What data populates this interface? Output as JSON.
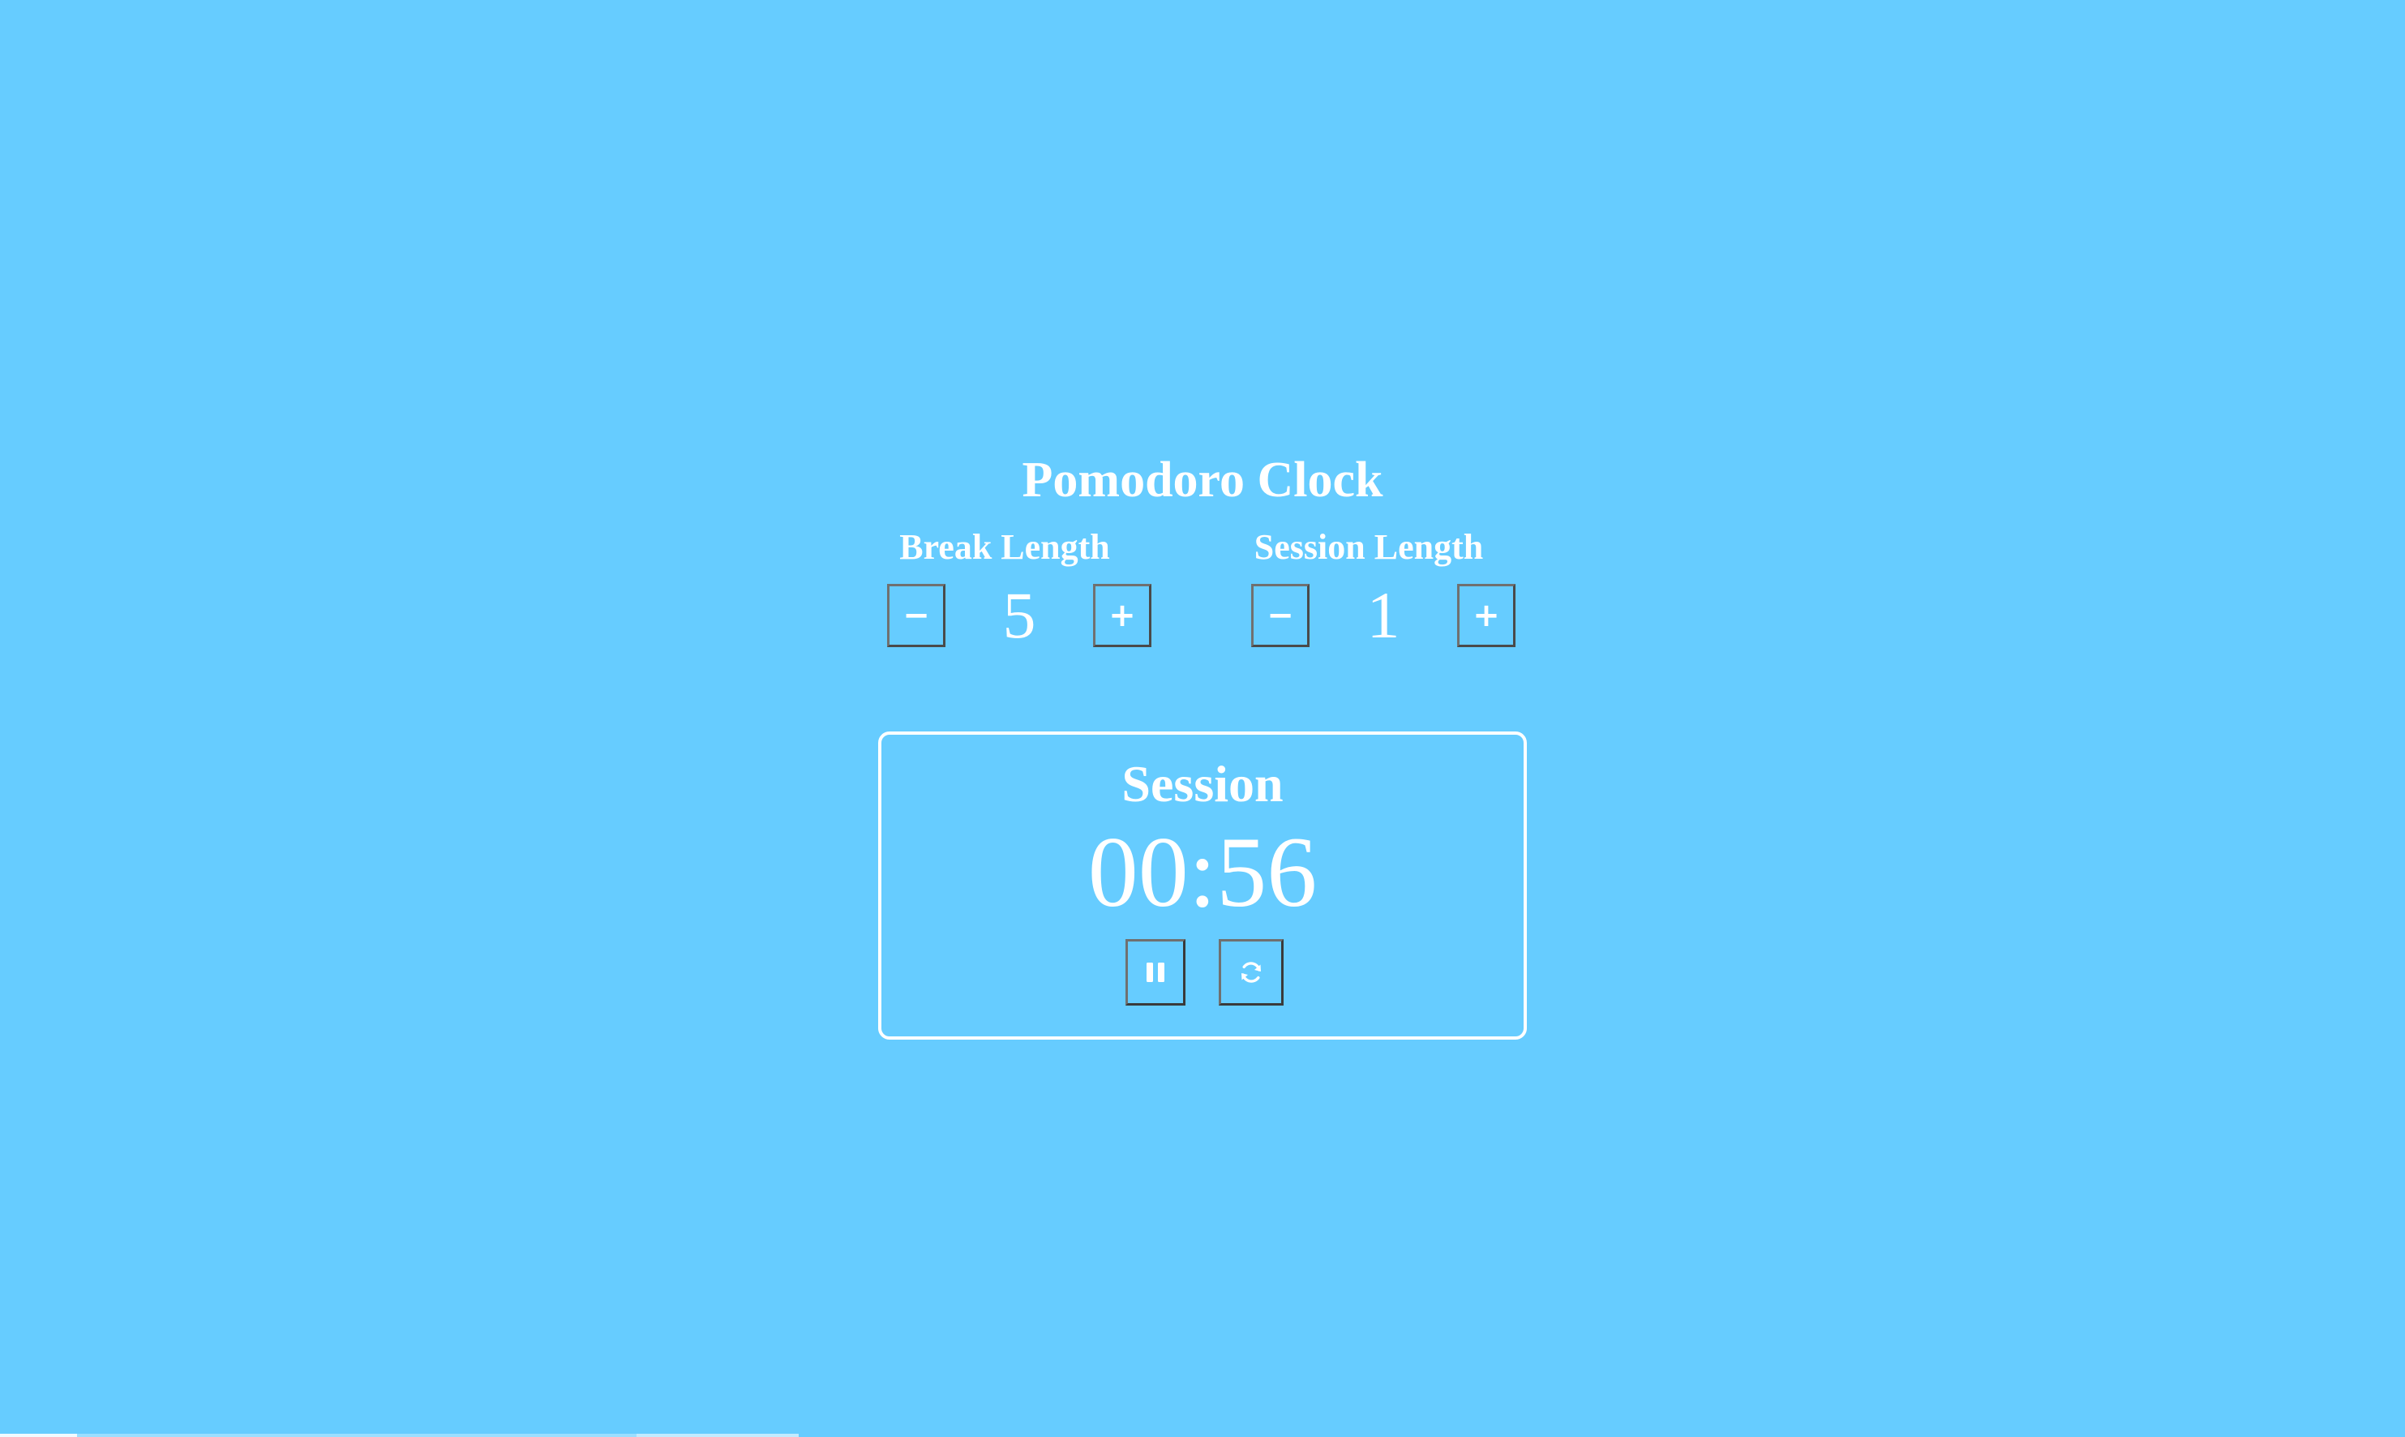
{
  "app": {
    "title": "Pomodoro Clock",
    "background_color": "#66ccff",
    "text_color": "#ffffff"
  },
  "break": {
    "label": "Break Length",
    "value": "5",
    "decrement_label": "−",
    "increment_label": "+"
  },
  "session": {
    "label": "Session Length",
    "value": "1",
    "decrement_label": "−",
    "increment_label": "+"
  },
  "timer": {
    "label": "Session",
    "time": "00:56",
    "pause_icon": "pause-icon",
    "reset_icon": "refresh-icon"
  }
}
